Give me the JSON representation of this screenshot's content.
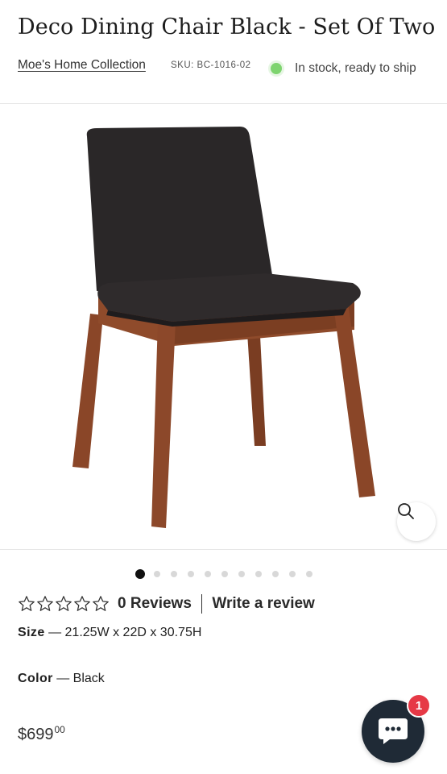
{
  "product": {
    "title": "Deco Dining Chair Black - Set Of Two",
    "vendor": "Moe's Home Collection",
    "sku": "SKU: BC-1016-02",
    "stock_status": "In stock, ready to ship",
    "stock_color": "#7ed46f"
  },
  "gallery": {
    "image_count": 11,
    "active_index": 0,
    "zoom_icon": "magnifier-icon"
  },
  "reviews": {
    "rating_stars": 0,
    "max_stars": 5,
    "count_label": "0 Reviews",
    "write_label": "Write a review"
  },
  "specs": {
    "size_label": "Size",
    "size_value": "— 21.25W x 22D x 30.75H",
    "color_label": "Color",
    "color_value": "— Black"
  },
  "price": {
    "main": "$699",
    "cents": "00"
  },
  "chat": {
    "icon": "chat-bubble-icon",
    "badge": "1",
    "button_color": "#1f2a36",
    "badge_color": "#e63946"
  }
}
